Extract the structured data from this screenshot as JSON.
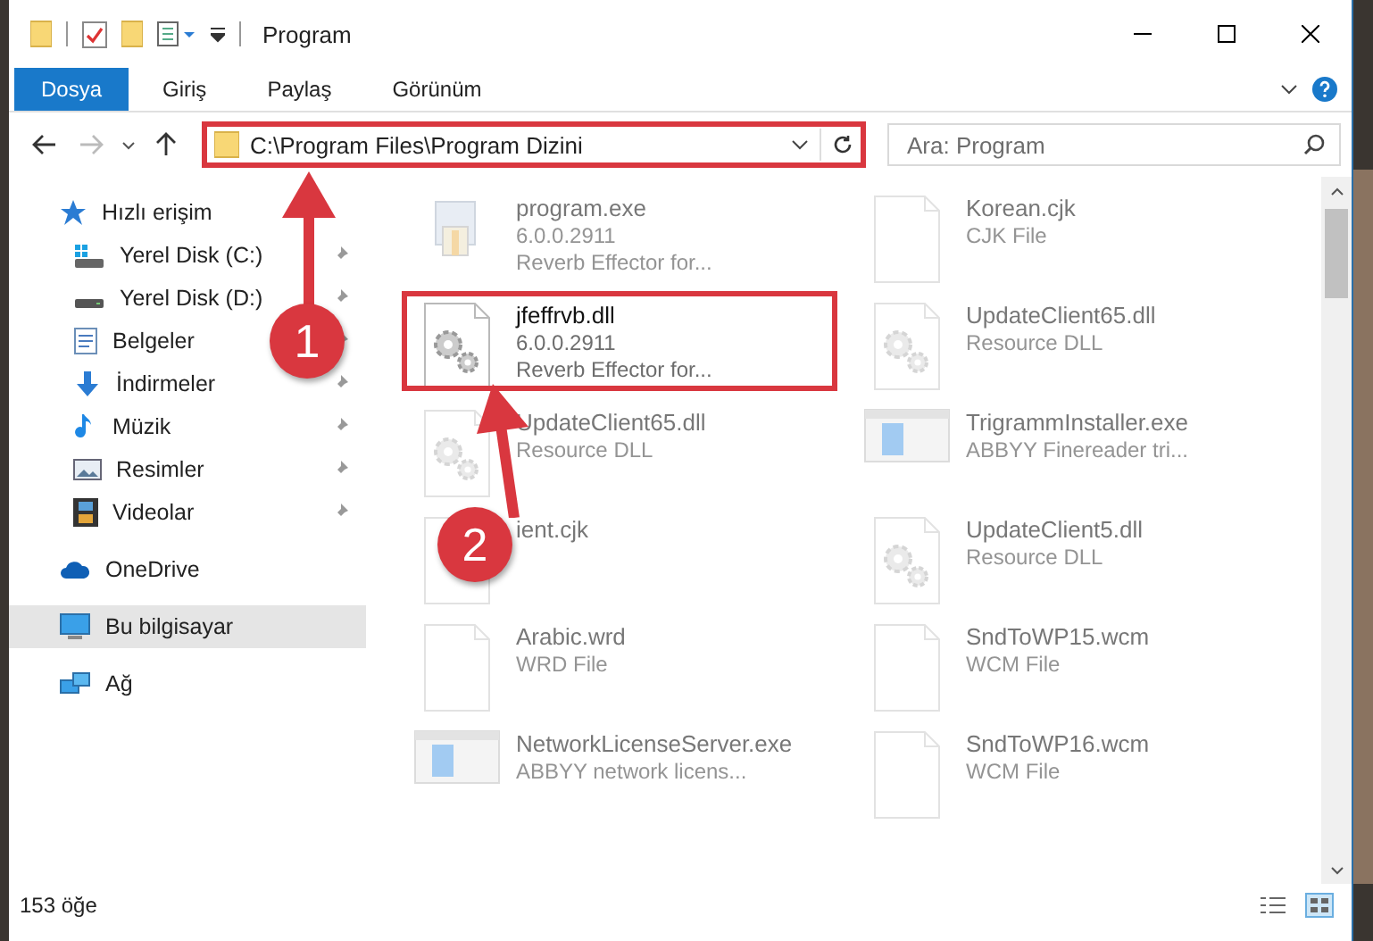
{
  "window": {
    "title": "Program"
  },
  "ribbon_tabs": [
    {
      "label": "Dosya",
      "selected": true
    },
    {
      "label": "Giriş",
      "selected": false
    },
    {
      "label": "Paylaş",
      "selected": false
    },
    {
      "label": "Görünüm",
      "selected": false
    }
  ],
  "address_bar": {
    "path": "C:\\Program Files\\Program Dizini",
    "annotated": true
  },
  "search": {
    "placeholder": "Ara: Program"
  },
  "sidebar": {
    "items": [
      {
        "label": "Hızlı erişim",
        "kind": "quick",
        "selected": false,
        "children": [
          {
            "label": "Yerel Disk (C:)",
            "kind": "drive-c",
            "pinned": true,
            "selected": false
          },
          {
            "label": "Yerel Disk (D:)",
            "kind": "drive",
            "pinned": true,
            "selected": false
          },
          {
            "label": "Belgeler",
            "kind": "documents",
            "pinned": true,
            "selected": false
          },
          {
            "label": "İndirmeler",
            "kind": "downloads",
            "pinned": true,
            "selected": false
          },
          {
            "label": "Müzik",
            "kind": "music",
            "pinned": true,
            "selected": false
          },
          {
            "label": "Resimler",
            "kind": "pictures",
            "pinned": true,
            "selected": false
          },
          {
            "label": "Videolar",
            "kind": "videos",
            "pinned": true,
            "selected": false
          }
        ]
      },
      {
        "label": "OneDrive",
        "kind": "onedrive",
        "selected": false
      },
      {
        "label": "Bu bilgisayar",
        "kind": "pc",
        "selected": true
      },
      {
        "label": "Ağ",
        "kind": "network",
        "selected": false
      }
    ]
  },
  "files": [
    {
      "name": "program.exe",
      "details": [
        "6.0.0.2911",
        "Reverb Effector for..."
      ],
      "kind": "exe",
      "dimmed": true,
      "annotated": false
    },
    {
      "name": "Korean.cjk",
      "details": [
        "CJK File"
      ],
      "kind": "doc",
      "dimmed": true,
      "annotated": false
    },
    {
      "name": "jfeffrvb.dll",
      "details": [
        "6.0.0.2911",
        "Reverb Effector for..."
      ],
      "kind": "dll",
      "dimmed": false,
      "annotated": true
    },
    {
      "name": "UpdateClient65.dll",
      "details": [
        "Resource DLL"
      ],
      "kind": "dll",
      "dimmed": true,
      "annotated": false
    },
    {
      "name": "UpdateClient65.dll",
      "details": [
        "Resource DLL"
      ],
      "kind": "dll",
      "dimmed": true,
      "annotated": false
    },
    {
      "name": "TrigrammInstaller.exe",
      "details": [
        "ABBYY Finereader tri..."
      ],
      "kind": "app",
      "dimmed": true,
      "annotated": false
    },
    {
      "name": "ient.cjk",
      "kind": "doc",
      "dimmed": true,
      "annotated": false
    },
    {
      "name": "UpdateClient5.dll",
      "details": [
        "Resource DLL"
      ],
      "kind": "dll",
      "dimmed": true,
      "annotated": false
    },
    {
      "name": "Arabic.wrd",
      "details": [
        "WRD File"
      ],
      "kind": "doc",
      "dimmed": true,
      "annotated": false
    },
    {
      "name": "SndToWP15.wcm",
      "details": [
        "WCM File"
      ],
      "kind": "doc",
      "dimmed": true,
      "annotated": false
    },
    {
      "name": "NetworkLicenseServer.exe",
      "details": [
        "ABBYY network licens..."
      ],
      "kind": "app",
      "dimmed": true,
      "annotated": false
    },
    {
      "name": "SndToWP16.wcm",
      "details": [
        "WCM File"
      ],
      "kind": "doc",
      "dimmed": true,
      "annotated": false
    }
  ],
  "status_bar": {
    "count": "153 öğe"
  },
  "annotations": [
    {
      "label": "1"
    },
    {
      "label": "2"
    }
  ]
}
